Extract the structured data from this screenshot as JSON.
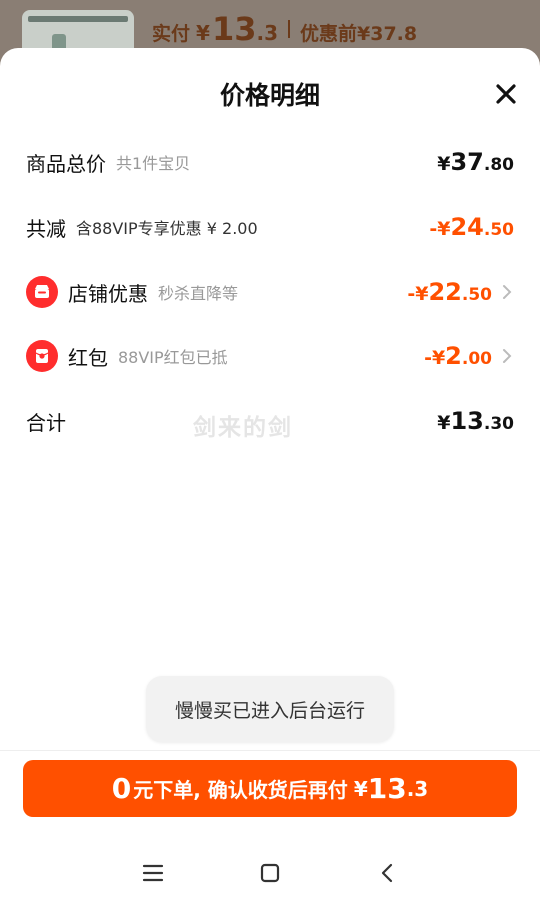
{
  "background": {
    "price_label": "实付",
    "currency": "¥",
    "price_int": "13",
    "price_dec": ".3",
    "prev_label": "优惠前",
    "prev_price": "¥37.8"
  },
  "sheet": {
    "title": "价格明细",
    "close_icon": "close-icon"
  },
  "rows": {
    "total": {
      "label": "商品总价",
      "sub": "共1件宝贝",
      "yen": "¥",
      "int": "37",
      "dec": ".80"
    },
    "reduce": {
      "label": "共减",
      "sub": "含88VIP专享优惠 ¥ 2.00",
      "yen": "-¥",
      "int": "24",
      "dec": ".50"
    },
    "store": {
      "label": "店铺优惠",
      "sub": "秒杀直降等",
      "yen": "-¥",
      "int": "22",
      "dec": ".50",
      "icon": "store-icon"
    },
    "redpacket": {
      "label": "红包",
      "sub": "88VIP红包已抵",
      "yen": "-¥",
      "int": "2",
      "dec": ".00",
      "icon": "red-packet-icon"
    },
    "sum": {
      "label": "合计",
      "yen": "¥",
      "int": "13",
      "dec": ".30"
    }
  },
  "watermark": "剑来的剑",
  "toast": "慢慢买已进入后台运行",
  "cta": {
    "num": "0",
    "text": "元下单, 确认收货后再付",
    "yen": "¥",
    "int": "13",
    "dec": ".3"
  },
  "colors": {
    "accent": "#ff5000",
    "badge": "#ff2d2d",
    "sub_text": "#999999"
  },
  "navbar": {
    "icons": [
      "menu-icon",
      "home-icon",
      "back-icon"
    ]
  }
}
